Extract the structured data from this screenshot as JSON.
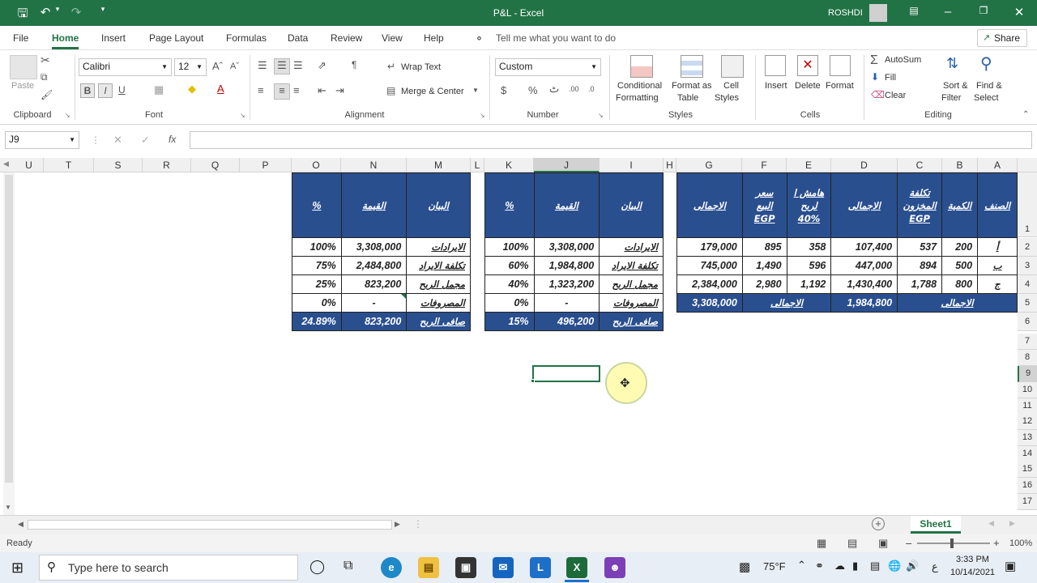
{
  "window": {
    "title": "P&L - Excel",
    "user": "ROSHDI"
  },
  "ribbon_tabs": [
    "File",
    "Home",
    "Insert",
    "Page Layout",
    "Formulas",
    "Data",
    "Review",
    "View",
    "Help"
  ],
  "tell_me": "Tell me what you want to do",
  "share": "Share",
  "clipboard": {
    "paste": "Paste",
    "group": "Clipboard"
  },
  "font": {
    "name": "Calibri",
    "size": "12",
    "group": "Font"
  },
  "alignment": {
    "wrap": "Wrap Text",
    "merge": "Merge & Center",
    "group": "Alignment"
  },
  "number": {
    "format": "Custom",
    "currency": "$",
    "percent": "%",
    "comma": "ٹ",
    "group": "Number"
  },
  "styles": {
    "cond1": "Conditional",
    "cond2": "Formatting",
    "fmt1": "Format as",
    "fmt2": "Table",
    "cell1": "Cell",
    "cell2": "Styles",
    "group": "Styles"
  },
  "cells": {
    "insert": "Insert",
    "delete": "Delete",
    "format": "Format",
    "group": "Cells"
  },
  "editing": {
    "autosum": "AutoSum",
    "fill": "Fill",
    "clear": "Clear",
    "sort1": "Sort &",
    "sort2": "Filter",
    "find1": "Find &",
    "find2": "Select",
    "group": "Editing"
  },
  "formula_bar": {
    "name_box": "J9",
    "fx": "fx",
    "value": ""
  },
  "columns": [
    "U",
    "T",
    "S",
    "R",
    "Q",
    "P",
    "O",
    "N",
    "M",
    "L",
    "K",
    "J",
    "I",
    "H",
    "G",
    "F",
    "E",
    "D",
    "C",
    "B",
    "A"
  ],
  "rows": [
    "1",
    "2",
    "3",
    "4",
    "5",
    "6",
    "7",
    "8",
    "9",
    "10",
    "11",
    "12",
    "13",
    "14",
    "15",
    "16",
    "17"
  ],
  "table_right": {
    "headers": [
      "الاجمالى",
      "سعر البيع EGP",
      "هامش ا لربح 40%",
      "الاجمالى",
      "تكلفة المخزون EGP",
      "الكمية",
      "الصنف"
    ],
    "rows": [
      [
        "179,000",
        "895",
        "358",
        "107,400",
        "537",
        "200",
        "أ"
      ],
      [
        "745,000",
        "1,490",
        "596",
        "447,000",
        "894",
        "500",
        "ب"
      ],
      [
        "2,384,000",
        "2,980",
        "1,192",
        "1,430,400",
        "1,788",
        "800",
        "ج"
      ]
    ],
    "total": {
      "sales_total": "3,308,000",
      "sales_label": "الاجمالى",
      "cost_total": "1,984,800",
      "cost_label": "الاجمالى"
    }
  },
  "table_mid": {
    "headers": [
      "%",
      "القيمة",
      "البيان"
    ],
    "rows": [
      [
        "100%",
        "3,308,000",
        "الايرادات"
      ],
      [
        "60%",
        "1,984,800",
        "تكلفة الايراد"
      ],
      [
        "40%",
        "1,323,200",
        "مجمل الربح"
      ],
      [
        "0%",
        "-",
        "المصروفات"
      ]
    ],
    "total": [
      "15%",
      "496,200",
      "صافى الربح"
    ]
  },
  "table_left": {
    "headers": [
      "%",
      "القيمة",
      "البيان"
    ],
    "rows": [
      [
        "100%",
        "3,308,000",
        "الايرادات"
      ],
      [
        "75%",
        "2,484,800",
        "تكلفة الايراد"
      ],
      [
        "25%",
        "823,200",
        "مجمل الربح"
      ],
      [
        "0%",
        "-",
        "المصروفات"
      ]
    ],
    "total": [
      "24.89%",
      "823,200",
      "صافى الربح"
    ]
  },
  "sheet_tab": "Sheet1",
  "status": {
    "ready": "Ready",
    "zoom": "100%"
  },
  "taskbar": {
    "search": "Type here to search",
    "temp": "75°F",
    "lang": "ع",
    "time": "3:33 PM",
    "date": "10/14/2021"
  },
  "colors": {
    "excel_green": "#217346",
    "table_header": "#2a4f8f"
  }
}
